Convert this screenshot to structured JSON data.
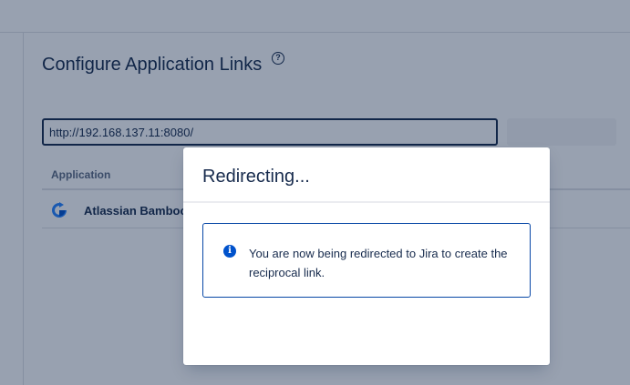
{
  "page": {
    "title": "Configure Application Links",
    "help_icon": "question-circle-icon",
    "help_glyph": "?"
  },
  "url_field": {
    "value": "http://192.168.137.11:8080/"
  },
  "create_button": {
    "label": ""
  },
  "table": {
    "columns": [
      "Application"
    ],
    "rows": [
      {
        "icon": "bamboo-refresh-icon",
        "name": "Atlassian Bamboo"
      }
    ]
  },
  "modal": {
    "title": "Redirecting...",
    "message": "You are now being redirected to Jira to create the reciprocal link.",
    "message_icon": "info-icon",
    "info_glyph": "i"
  },
  "colors": {
    "accent": "#0052cc",
    "text": "#172b4d",
    "border": "#dfe1e6",
    "blanket": "rgba(9,30,66,0.42)"
  }
}
